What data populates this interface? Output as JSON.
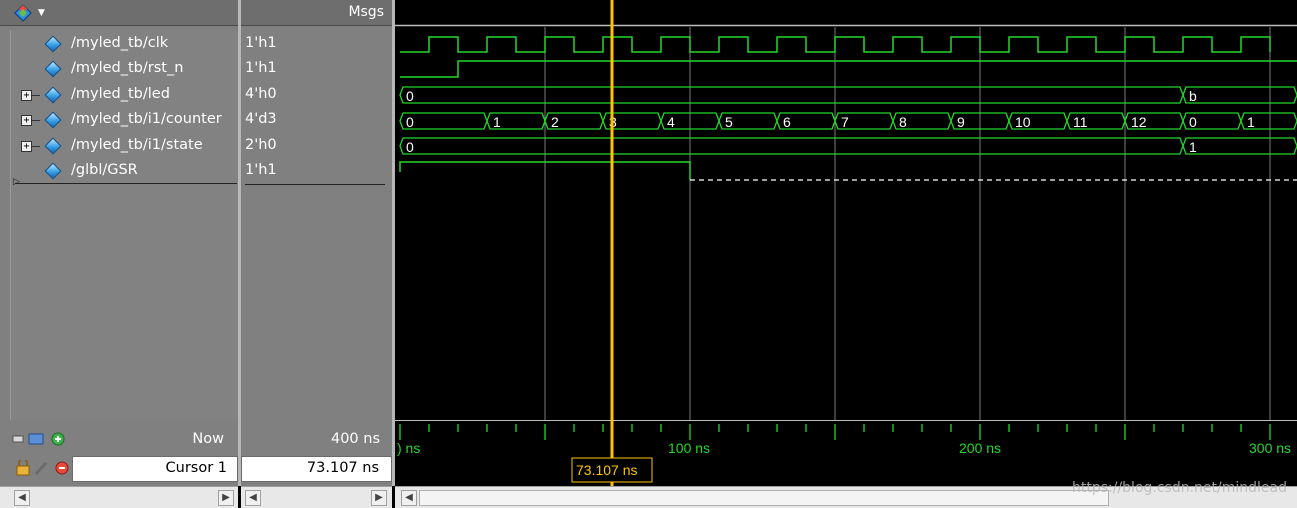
{
  "header": {
    "msgs_label": "Msgs"
  },
  "signals": [
    {
      "name": "/myled_tb/clk",
      "value": "1'h1",
      "expandable": false
    },
    {
      "name": "/myled_tb/rst_n",
      "value": "1'h1",
      "expandable": false
    },
    {
      "name": "/myled_tb/led",
      "value": "4'h0",
      "expandable": true
    },
    {
      "name": "/myled_tb/i1/counter",
      "value": "4'd3",
      "expandable": true
    },
    {
      "name": "/myled_tb/i1/state",
      "value": "2'h0",
      "expandable": true
    },
    {
      "name": "/glbl/GSR",
      "value": "1'h1",
      "expandable": false
    }
  ],
  "status": {
    "now_label": "Now",
    "now_value": "400 ns",
    "cursor_label": "Cursor 1",
    "cursor_value": "73.107 ns",
    "cursor_flag": "73.107 ns"
  },
  "timeline": {
    "tick_labels": [
      ") ns",
      "100 ns",
      "200 ns",
      "300 ns"
    ]
  },
  "waves": {
    "led": {
      "segments": [
        {
          "t0": 0,
          "label": "0"
        },
        {
          "t0": 270,
          "label": "b"
        }
      ]
    },
    "counter": {
      "segments": [
        {
          "t0": 0,
          "label": "0"
        },
        {
          "t0": 30,
          "label": "1"
        },
        {
          "t0": 50,
          "label": "2"
        },
        {
          "t0": 70,
          "label": "3"
        },
        {
          "t0": 90,
          "label": "4"
        },
        {
          "t0": 110,
          "label": "5"
        },
        {
          "t0": 130,
          "label": "6"
        },
        {
          "t0": 150,
          "label": "7"
        },
        {
          "t0": 170,
          "label": "8"
        },
        {
          "t0": 190,
          "label": "9"
        },
        {
          "t0": 210,
          "label": "10"
        },
        {
          "t0": 230,
          "label": "11"
        },
        {
          "t0": 250,
          "label": "12"
        },
        {
          "t0": 270,
          "label": "0"
        },
        {
          "t0": 290,
          "label": "1"
        }
      ]
    },
    "state": {
      "segments": [
        {
          "t0": 0,
          "label": "0"
        },
        {
          "t0": 270,
          "label": "1"
        }
      ]
    },
    "cursor_time_ns": 73.107
  },
  "colors": {
    "wave": "#22d82a",
    "cursor": "#ffc400",
    "grid": "#7a7a7a",
    "background": "#000000",
    "panel": "#808080"
  },
  "watermark": "https://blog.csdn.net/mindlead"
}
